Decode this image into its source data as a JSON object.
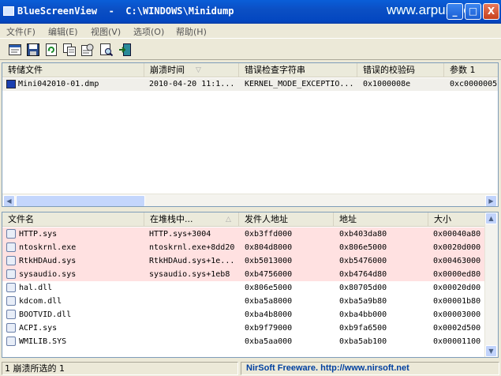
{
  "window": {
    "title": "BlueScreenView  -  C:\\WINDOWS\\Minidump",
    "watermark": "www.arpun.com",
    "minimize": "_",
    "maximize": "□",
    "close": "X"
  },
  "menu": [
    "文件(F)",
    "编辑(E)",
    "视图(V)",
    "选项(O)",
    "帮助(H)"
  ],
  "toolbar": [
    "html-report-icon",
    "save-icon",
    "refresh-icon",
    "copy-icon",
    "properties-icon",
    "find-icon",
    "exit-icon"
  ],
  "top_table": {
    "columns": [
      "转储文件",
      "崩溃时间",
      "错误检查字符串",
      "错误的校验码",
      "参数 1"
    ],
    "rows": [
      [
        "Mini042010-01.dmp",
        "2010-04-20 11:1...",
        "KERNEL_MODE_EXCEPTIO...",
        "0x1000008e",
        "0xc0000005"
      ]
    ]
  },
  "bottom_table": {
    "columns": [
      "文件名",
      "在堆栈中...",
      "发件人地址",
      "地址",
      "大小"
    ],
    "rows": [
      {
        "c": [
          "HTTP.sys",
          "HTTP.sys+3004",
          "0xb3ffd000",
          "0xb403da80",
          "0x00040a80"
        ],
        "hl": true
      },
      {
        "c": [
          "ntoskrnl.exe",
          "ntoskrnl.exe+8dd20",
          "0x804d8000",
          "0x806e5000",
          "0x0020d000"
        ],
        "hl": true
      },
      {
        "c": [
          "RtkHDAud.sys",
          "RtkHDAud.sys+1e...",
          "0xb5013000",
          "0xb5476000",
          "0x00463000"
        ],
        "hl": true
      },
      {
        "c": [
          "sysaudio.sys",
          "sysaudio.sys+1eb8",
          "0xb4756000",
          "0xb4764d80",
          "0x0000ed80"
        ],
        "hl": true
      },
      {
        "c": [
          "hal.dll",
          "",
          "0x806e5000",
          "0x80705d00",
          "0x00020d00"
        ],
        "hl": false
      },
      {
        "c": [
          "kdcom.dll",
          "",
          "0xba5a8000",
          "0xba5a9b80",
          "0x00001b80"
        ],
        "hl": false
      },
      {
        "c": [
          "BOOTVID.dll",
          "",
          "0xba4b8000",
          "0xba4bb000",
          "0x00003000"
        ],
        "hl": false
      },
      {
        "c": [
          "ACPI.sys",
          "",
          "0xb9f79000",
          "0xb9fa6500",
          "0x0002d500"
        ],
        "hl": false
      },
      {
        "c": [
          "WMILIB.SYS",
          "",
          "0xba5aa000",
          "0xba5ab100",
          "0x00001100"
        ],
        "hl": false
      }
    ]
  },
  "status": {
    "count": "1 崩溃所选的 1",
    "credit": "NirSoft Freeware.  http://www.nirsoft.net"
  },
  "colors": {
    "highlight_row": "#ffe1e1",
    "title_bar": "#0a5ed8"
  }
}
